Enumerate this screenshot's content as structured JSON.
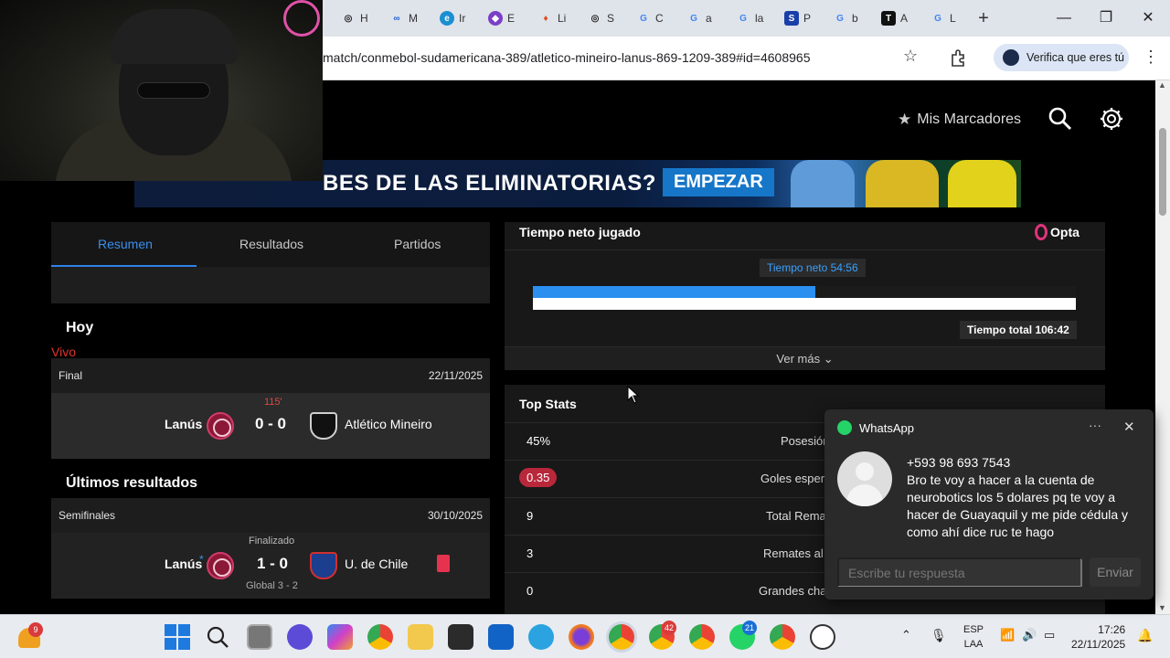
{
  "browser": {
    "tabs": [
      {
        "label": "H",
        "icon": "chatgpt-icon",
        "color": "#222"
      },
      {
        "label": "M",
        "icon": "meta-icon",
        "color": "#1a5fd6"
      },
      {
        "label": "Ir",
        "icon": "edge-copilot-icon",
        "color": "#1b8fd1"
      },
      {
        "label": "E",
        "icon": "shield-app-icon",
        "color": "#7b3fc6"
      },
      {
        "label": "Li",
        "icon": "flame-icon",
        "color": "#e24a1a"
      },
      {
        "label": "S",
        "icon": "chatgpt-icon",
        "color": "#222"
      },
      {
        "label": "C",
        "icon": "google-icon",
        "color": "#4285f4"
      },
      {
        "label": "a",
        "icon": "google-icon",
        "color": "#4285f4"
      },
      {
        "label": "la",
        "icon": "google-icon",
        "color": "#4285f4"
      },
      {
        "label": "P",
        "icon": "document-icon",
        "color": "#1a3fa8"
      },
      {
        "label": "b",
        "icon": "google-icon",
        "color": "#4285f4"
      },
      {
        "label": "A",
        "icon": "video-app-icon",
        "color": "#111"
      },
      {
        "label": "L",
        "icon": "google-icon",
        "color": "#4285f4"
      }
    ],
    "new_tab": "+",
    "url": "match/conmebol-sudamericana-389/atletico-mineiro-lanus-869-1209-389#id=4608965",
    "verify_label": "Verifica que eres tú",
    "window_controls": {
      "minimize": "—",
      "maximize": "❐",
      "close": "✕"
    }
  },
  "header": {
    "mis_marcadores": "Mis Marcadores"
  },
  "banner": {
    "text": "BES DE LAS ELIMINATORIAS?",
    "cta": "EMPEZAR"
  },
  "left": {
    "tabs": [
      "Resumen",
      "Resultados",
      "Partidos"
    ],
    "hoy": "Hoy",
    "vivo": "Vivo",
    "today_match": {
      "stage": "Final",
      "date": "22/11/2025",
      "minute": "115'",
      "home": "Lanús",
      "score": "0 - 0",
      "away": "Atlético Mineiro"
    },
    "ultimos": "Últimos resultados",
    "last_match": {
      "stage": "Semifinales",
      "date": "30/10/2025",
      "status": "Finalizado",
      "home": "Lanús",
      "home_marker": "*",
      "score": "1 - 0",
      "away": "U. de Chile",
      "aggregate": "Global 3 - 2"
    }
  },
  "net_time": {
    "title": "Tiempo neto jugado",
    "provider": "Opta",
    "net_label": "Tiempo neto 54:56",
    "total_label": "Tiempo total 106:42",
    "fraction": 0.52,
    "ver_mas": "Ver más"
  },
  "top_stats": {
    "title": "Top Stats",
    "rows": [
      {
        "value": "45%",
        "label": "Posesión"
      },
      {
        "value": "0.35",
        "label": "Goles esper"
      },
      {
        "value": "9",
        "label": "Total Rema"
      },
      {
        "value": "3",
        "label": "Remates al"
      },
      {
        "value": "0",
        "label": "Grandes cha"
      }
    ]
  },
  "whatsapp": {
    "title": "WhatsApp",
    "more": "···",
    "close": "✕",
    "sender": "+593 98 693 7543",
    "message": "Bro te voy a hacer a la cuenta de neurobotics los 5 dolares pq te voy a hacer de Guayaquil y me pide cédula y como ahí dice ruc te hago",
    "reply_placeholder": "Escribe tu respuesta",
    "send": "Enviar"
  },
  "taskbar": {
    "weather_badge": "9",
    "chrome_badge_1": "42",
    "whatsapp_badge": "21",
    "lang": "ESP",
    "layout": "LAA",
    "time": "17:26",
    "date": "22/11/2025"
  },
  "colors": {
    "accent_blue": "#2f83e8",
    "live_red": "#e0332e",
    "xg_red": "#b8283a",
    "bar_blue": "#2b8ff0"
  }
}
